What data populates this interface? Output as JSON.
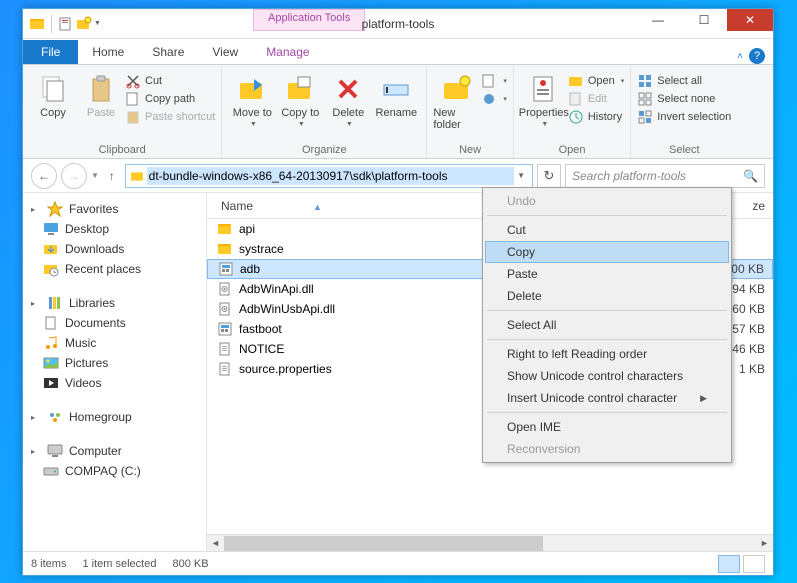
{
  "window": {
    "title": "platform-tools",
    "app_tools_label": "Application Tools"
  },
  "tabs": {
    "file": "File",
    "home": "Home",
    "share": "Share",
    "view": "View",
    "manage": "Manage"
  },
  "ribbon": {
    "clipboard": {
      "label": "Clipboard",
      "copy": "Copy",
      "paste": "Paste",
      "cut": "Cut",
      "copy_path": "Copy path",
      "paste_shortcut": "Paste shortcut"
    },
    "organize": {
      "label": "Organize",
      "move_to": "Move to",
      "copy_to": "Copy to",
      "delete": "Delete",
      "rename": "Rename"
    },
    "new": {
      "label": "New",
      "new_folder": "New folder"
    },
    "open": {
      "label": "Open",
      "properties": "Properties",
      "open": "Open",
      "edit": "Edit",
      "history": "History"
    },
    "select": {
      "label": "Select",
      "select_all": "Select all",
      "select_none": "Select none",
      "invert": "Invert selection"
    }
  },
  "address": {
    "path": "dt-bundle-windows-x86_64-20130917\\sdk\\platform-tools"
  },
  "search": {
    "placeholder": "Search platform-tools"
  },
  "nav": {
    "favorites": "Favorites",
    "desktop": "Desktop",
    "downloads": "Downloads",
    "recent": "Recent places",
    "libraries": "Libraries",
    "documents": "Documents",
    "music": "Music",
    "pictures": "Pictures",
    "videos": "Videos",
    "homegroup": "Homegroup",
    "computer": "Computer",
    "drive": "COMPAQ (C:)"
  },
  "columns": {
    "name": "Name",
    "size": "ze"
  },
  "files": [
    {
      "name": "api",
      "type": "folder",
      "size": ""
    },
    {
      "name": "systrace",
      "type": "folder",
      "size": ""
    },
    {
      "name": "adb",
      "type": "exe",
      "size": "800 KB",
      "selected": true
    },
    {
      "name": "AdbWinApi.dll",
      "type": "dll",
      "size": "94 KB"
    },
    {
      "name": "AdbWinUsbApi.dll",
      "type": "dll",
      "size": "60 KB"
    },
    {
      "name": "fastboot",
      "type": "exe",
      "size": "157 KB"
    },
    {
      "name": "NOTICE",
      "type": "txt",
      "size": "246 KB"
    },
    {
      "name": "source.properties",
      "type": "txt",
      "size": "1 KB"
    }
  ],
  "context_menu": {
    "undo": "Undo",
    "cut": "Cut",
    "copy": "Copy",
    "paste": "Paste",
    "delete": "Delete",
    "select_all": "Select All",
    "rtl": "Right to left Reading order",
    "show_uni": "Show Unicode control characters",
    "insert_uni": "Insert Unicode control character",
    "open_ime": "Open IME",
    "reconv": "Reconversion"
  },
  "status": {
    "items": "8 items",
    "selected": "1 item selected",
    "size": "800 KB"
  }
}
